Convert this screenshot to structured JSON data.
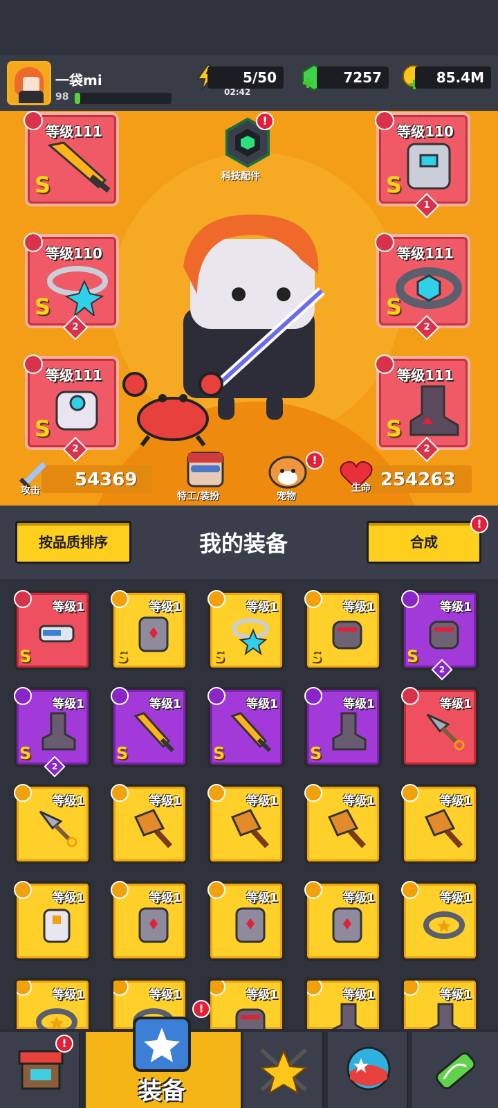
{
  "player": {
    "name": "一袋mi",
    "level": "98",
    "exp_fraction": 0.06
  },
  "resources": {
    "energy": "5/50",
    "energy_timer": "02:42",
    "gems": "7257",
    "coins": "85.4M"
  },
  "tech": {
    "label": "科技配件",
    "badge": "!"
  },
  "equipped": {
    "weapon": {
      "level": "等级111",
      "grade": "S"
    },
    "armor": {
      "level": "等级110",
      "grade": "S",
      "stars": "1"
    },
    "necklace": {
      "level": "等级110",
      "grade": "S",
      "stars": "2"
    },
    "belt": {
      "level": "等级111",
      "grade": "S",
      "stars": "2"
    },
    "gloves": {
      "level": "等级111",
      "grade": "S",
      "stars": "2"
    },
    "boots": {
      "level": "等级111",
      "grade": "S",
      "stars": "2"
    }
  },
  "stats": {
    "attack_label": "攻击",
    "attack": "54369",
    "hp_label": "生命",
    "hp": "254263",
    "agent_label": "特工/装扮",
    "pet_label": "宠物",
    "pet_badge": "!"
  },
  "section": {
    "sort_button": "按品质排序",
    "title": "我的装备",
    "merge_button": "合成",
    "merge_badge": "!"
  },
  "inventory": [
    {
      "level": "等级1",
      "grade": "S",
      "rarity": "red",
      "icon": "gun-icon"
    },
    {
      "level": "等级1",
      "grade": "S",
      "rarity": "yellow",
      "icon": "armor-icon"
    },
    {
      "level": "等级1",
      "grade": "S",
      "rarity": "yellow",
      "icon": "necklace-icon"
    },
    {
      "level": "等级1",
      "grade": "S",
      "rarity": "yellow",
      "icon": "gloves-icon"
    },
    {
      "level": "等级1",
      "grade": "S",
      "rarity": "purple",
      "icon": "gloves-icon",
      "stars": "2"
    },
    {
      "level": "等级1",
      "grade": "S",
      "rarity": "purple",
      "icon": "boots-icon",
      "stars": "2"
    },
    {
      "level": "等级1",
      "grade": "S",
      "rarity": "purple",
      "icon": "sword-icon"
    },
    {
      "level": "等级1",
      "grade": "S",
      "rarity": "purple",
      "icon": "sword-icon"
    },
    {
      "level": "等级1",
      "grade": "S",
      "rarity": "purple",
      "icon": "boots-icon"
    },
    {
      "level": "等级1",
      "grade": "",
      "rarity": "red",
      "icon": "kunai-icon"
    },
    {
      "level": "等级1",
      "grade": "",
      "rarity": "yellow",
      "icon": "kunai-icon"
    },
    {
      "level": "等级1",
      "grade": "",
      "rarity": "yellow",
      "icon": "drill-icon"
    },
    {
      "level": "等级1",
      "grade": "",
      "rarity": "yellow",
      "icon": "drill-icon"
    },
    {
      "level": "等级1",
      "grade": "",
      "rarity": "yellow",
      "icon": "drill-icon"
    },
    {
      "level": "等级1",
      "grade": "",
      "rarity": "yellow",
      "icon": "drill-icon"
    },
    {
      "level": "等级1",
      "grade": "",
      "rarity": "yellow",
      "icon": "vest-icon"
    },
    {
      "level": "等级1",
      "grade": "",
      "rarity": "yellow",
      "icon": "armor-icon"
    },
    {
      "level": "等级1",
      "grade": "",
      "rarity": "yellow",
      "icon": "armor-icon"
    },
    {
      "level": "等级1",
      "grade": "",
      "rarity": "yellow",
      "icon": "armor-icon"
    },
    {
      "level": "等级1",
      "grade": "",
      "rarity": "yellow",
      "icon": "belt-icon"
    },
    {
      "level": "等级1",
      "grade": "",
      "rarity": "yellow",
      "icon": "belt-icon"
    },
    {
      "level": "等级1",
      "grade": "",
      "rarity": "yellow",
      "icon": "belt-icon"
    },
    {
      "level": "等级1",
      "grade": "",
      "rarity": "yellow",
      "icon": "gloves-icon"
    },
    {
      "level": "等级1",
      "grade": "",
      "rarity": "yellow",
      "icon": "boots-icon"
    },
    {
      "level": "等级1",
      "grade": "",
      "rarity": "yellow",
      "icon": "boots-icon"
    }
  ],
  "nav": {
    "shop_badge": "!",
    "equip_label": "装备",
    "equip_badge": "!"
  }
}
